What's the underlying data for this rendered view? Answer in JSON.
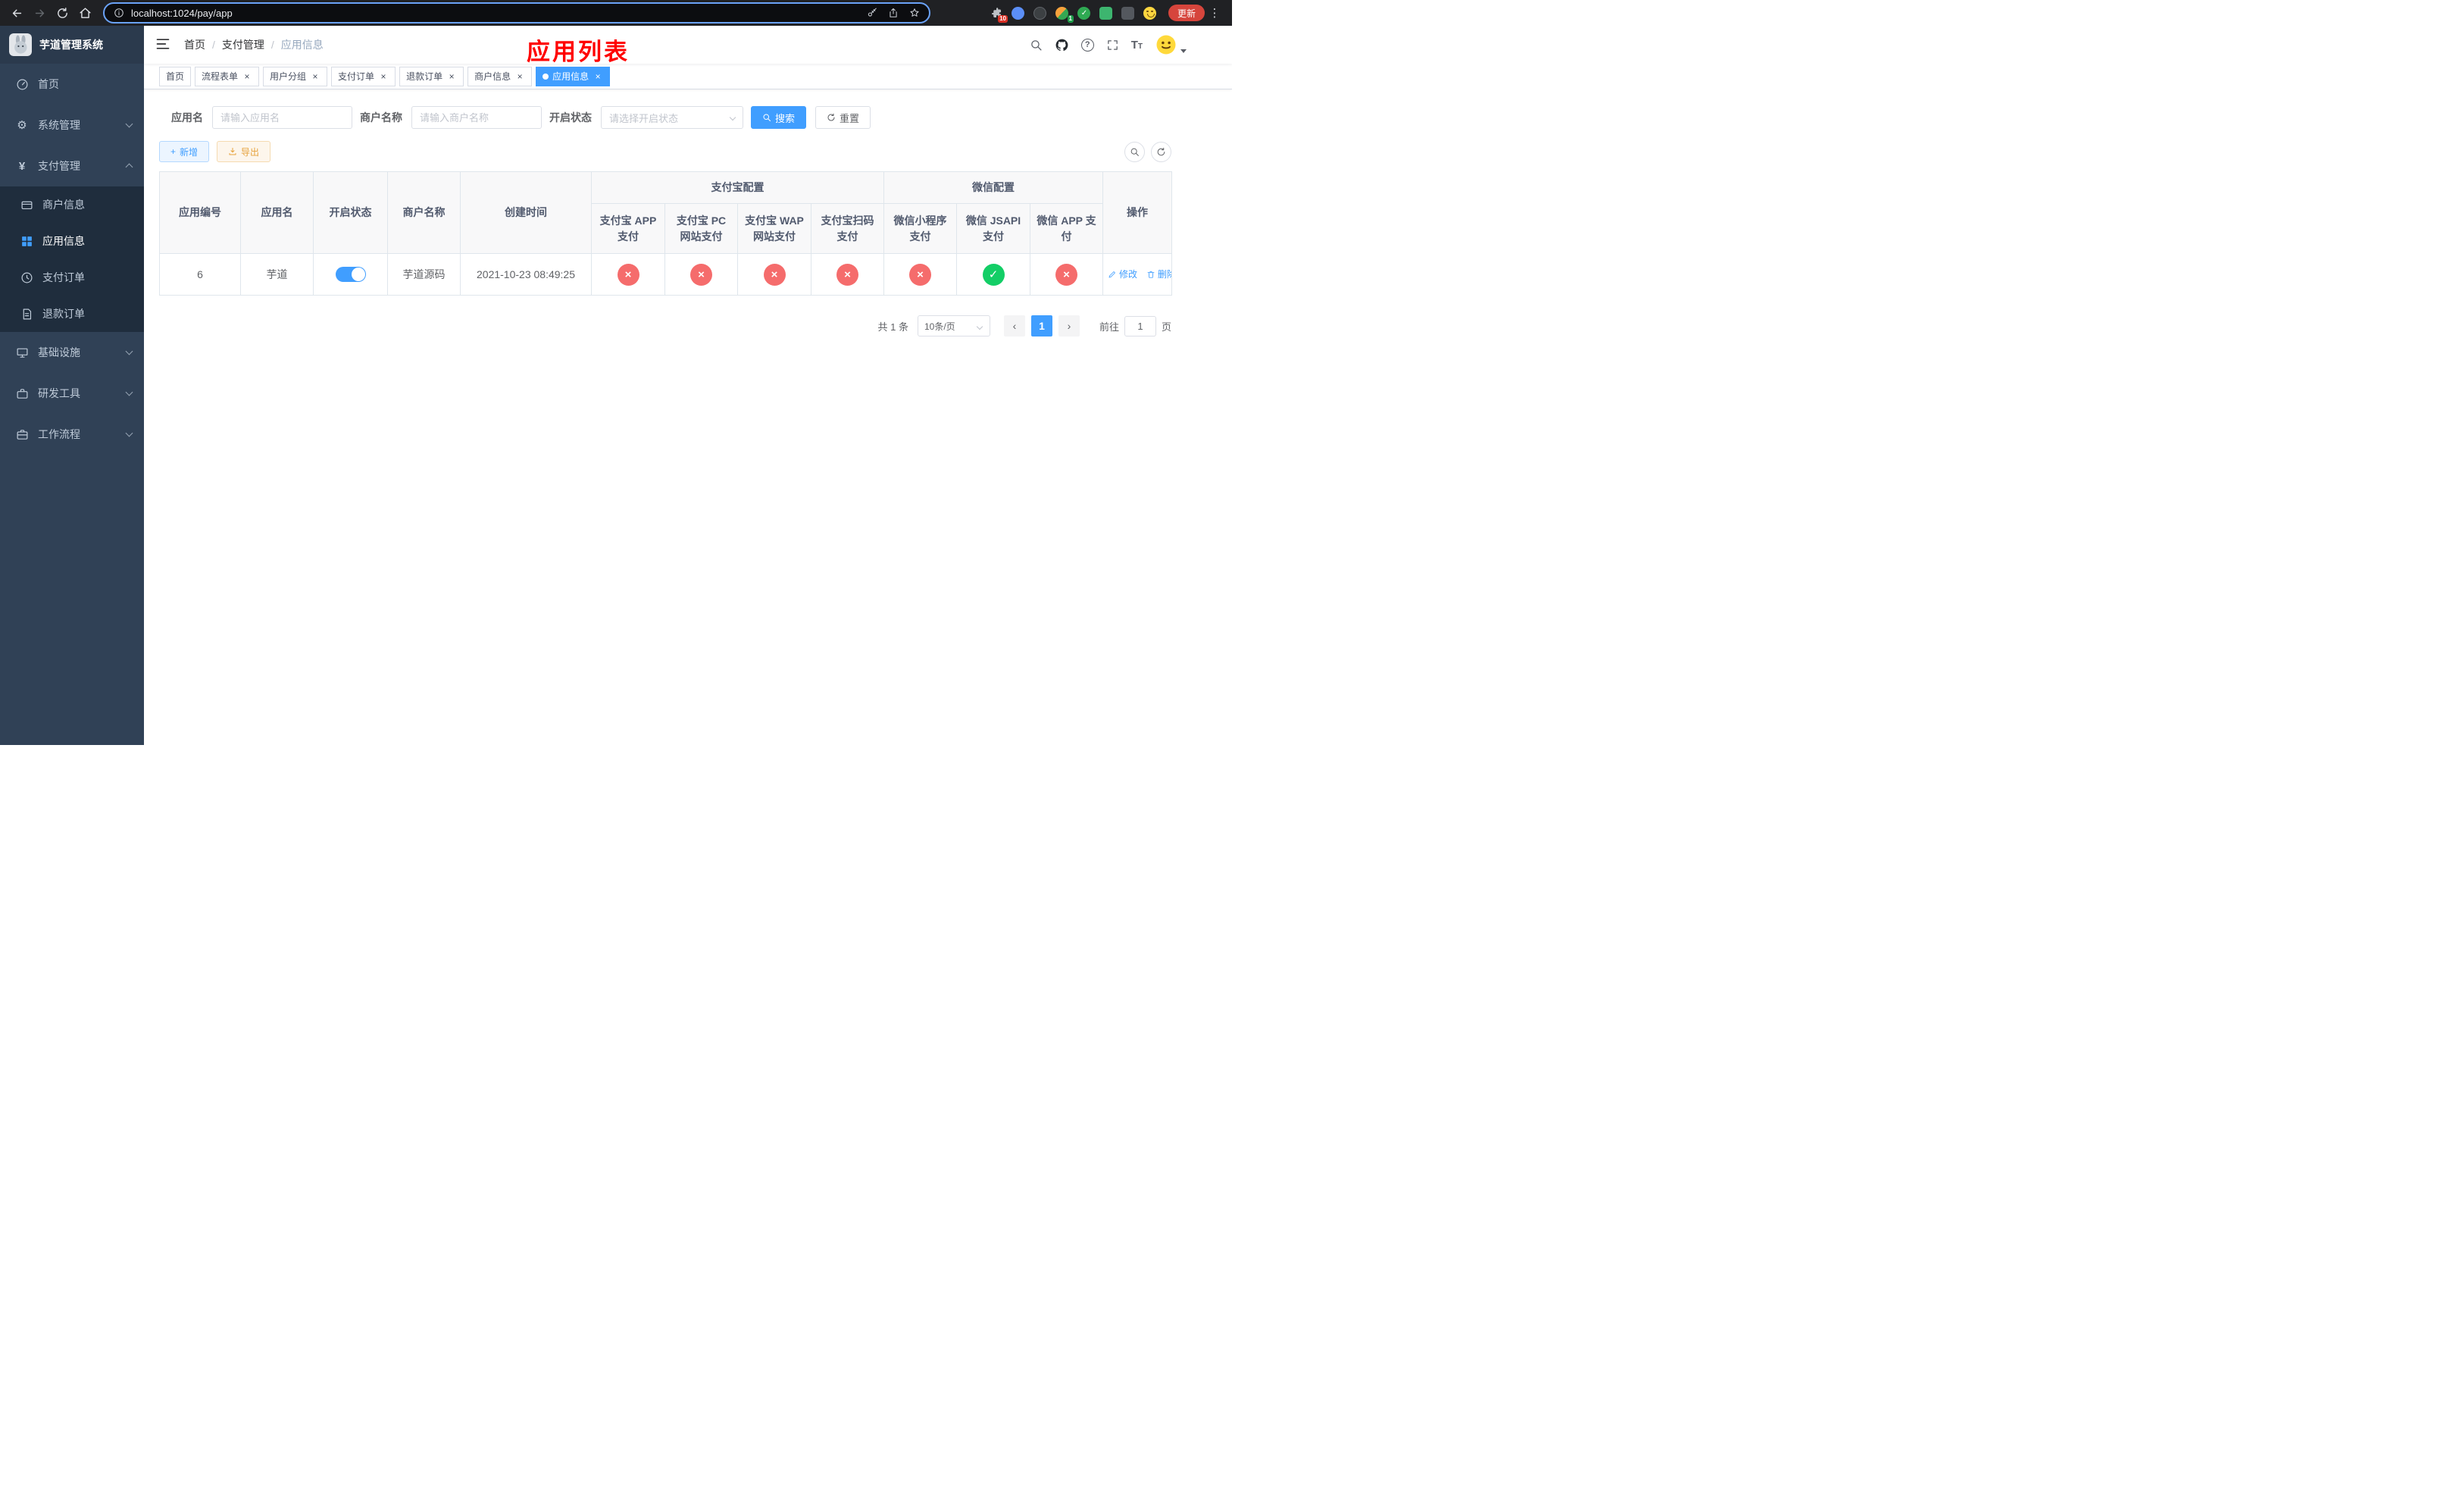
{
  "colors": {
    "accent": "#409eff",
    "danger": "#f56c6c",
    "success": "#13ce66",
    "warning": "#e6a23c",
    "overlay_title_red": "#ff0000",
    "sidebar_bg": "#304156",
    "submenu_bg": "#1f2d3d"
  },
  "icons": {
    "close": "×",
    "cross": "×",
    "check": "✓",
    "plus": "+",
    "dots": "⋮",
    "prev": "‹",
    "next": "›",
    "question": "?",
    "yen": "¥",
    "gear": "⚙"
  },
  "browser": {
    "url": "localhost:1024/pay/app",
    "update_button": "更新",
    "puzzle_badge": "10",
    "ext_badge": "1"
  },
  "sidebar": {
    "app_title": "芋道管理系统",
    "items": [
      {
        "label": "首页"
      },
      {
        "label": "系统管理"
      },
      {
        "label": "支付管理",
        "expanded": true
      },
      {
        "label": "基础设施"
      },
      {
        "label": "研发工具"
      },
      {
        "label": "工作流程"
      }
    ],
    "payment_children": [
      {
        "label": "商户信息"
      },
      {
        "label": "应用信息",
        "active": true
      },
      {
        "label": "支付订单"
      },
      {
        "label": "退款订单"
      }
    ]
  },
  "navbar": {
    "breadcrumb": [
      "首页",
      "支付管理",
      "应用信息"
    ],
    "separator": "/",
    "overlay_title": "应用列表"
  },
  "tabs": [
    {
      "label": "首页",
      "closable": false
    },
    {
      "label": "流程表单",
      "closable": true
    },
    {
      "label": "用户分组",
      "closable": true
    },
    {
      "label": "支付订单",
      "closable": true
    },
    {
      "label": "退款订单",
      "closable": true
    },
    {
      "label": "商户信息",
      "closable": true
    },
    {
      "label": "应用信息",
      "closable": true,
      "active": true
    }
  ],
  "filters": {
    "app_name_label": "应用名",
    "app_name_placeholder": "请输入应用名",
    "merchant_label": "商户名称",
    "merchant_placeholder": "请输入商户名称",
    "status_label": "开启状态",
    "status_placeholder": "请选择开启状态",
    "search_button": "搜索",
    "reset_button": "重置"
  },
  "toolbar": {
    "add_button": "新增",
    "export_button": "导出"
  },
  "table": {
    "columns": [
      "应用编号",
      "应用名",
      "开启状态",
      "商户名称",
      "创建时间"
    ],
    "alipay_group": "支付宝配置",
    "wechat_group": "微信配置",
    "alipay_columns": [
      "支付宝 APP 支付",
      "支付宝 PC 网站支付",
      "支付宝 WAP 网站支付",
      "支付宝扫码支付"
    ],
    "wechat_columns": [
      "微信小程序支付",
      "微信 JSAPI 支付",
      "微信 APP 支付"
    ],
    "actions_column": "操作",
    "rows": [
      {
        "id": "6",
        "name": "芋道",
        "enabled": true,
        "merchant": "芋道源码",
        "created_at": "2021-10-23 08:49:25",
        "statuses": [
          "cross",
          "cross",
          "cross",
          "cross",
          "cross",
          "check",
          "cross"
        ],
        "edit_label": "修改",
        "delete_label": "删除"
      }
    ]
  },
  "pagination": {
    "total_text": "共 1 条",
    "page_size": "10条/页",
    "current_page": "1",
    "goto_label": "前往",
    "goto_value": "1",
    "unit_label": "页"
  }
}
